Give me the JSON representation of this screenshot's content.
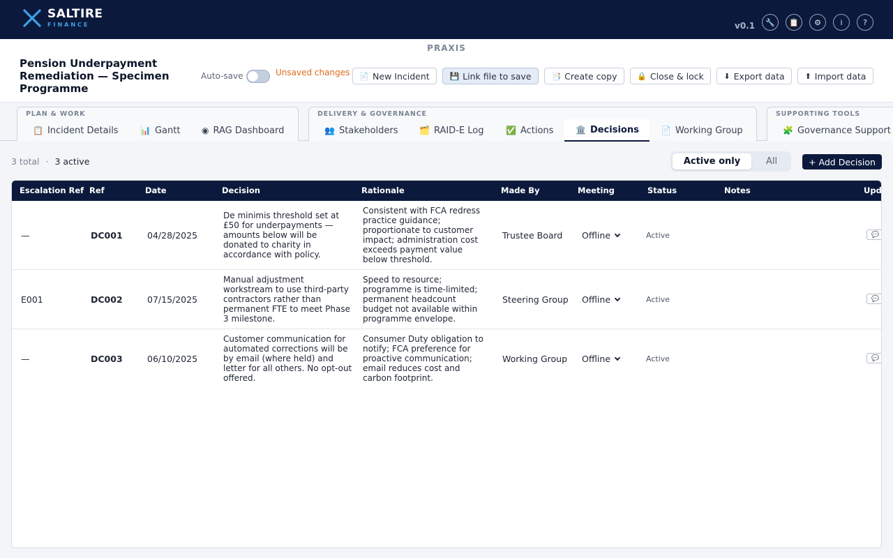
{
  "brand": {
    "name": "SALTIRE",
    "sub": "FINANCE",
    "version": "v0.1"
  },
  "top_icons": [
    "wrench-icon",
    "clipboard-icon",
    "gear-icon",
    "info-icon",
    "help-icon"
  ],
  "top_icon_glyphs": [
    "🔧",
    "📋",
    "⚙",
    "i",
    "?"
  ],
  "app_label": "PRAXIS",
  "programme_title": "Pension Underpayment Remediation — Specimen Programme",
  "autosave": {
    "label": "Auto-save",
    "enabled": false,
    "unsaved": "Unsaved changes"
  },
  "header_buttons": {
    "new_incident": "New Incident",
    "link_file": "Link file to save",
    "create_copy": "Create copy",
    "close_lock": "Close & lock",
    "export": "Export data",
    "import": "Import data"
  },
  "tab_groups": {
    "plan": {
      "label": "PLAN & WORK",
      "tabs": [
        "Incident Details",
        "Gantt",
        "RAG Dashboard"
      ]
    },
    "delivery": {
      "label": "DELIVERY & GOVERNANCE",
      "tabs": [
        "Stakeholders",
        "RAID-E Log",
        "Actions",
        "Decisions",
        "Working Group"
      ]
    },
    "support": {
      "label": "SUPPORTING TOOLS",
      "tabs": [
        "Governance Support"
      ]
    }
  },
  "active_tab": "Decisions",
  "summary": {
    "total": "3 total",
    "sep": "·",
    "active": "3 active"
  },
  "filter": {
    "active_only": "Active only",
    "all": "All",
    "selected": "Active only"
  },
  "add_button": "+ Add Decision",
  "table": {
    "headers": {
      "escalation": "Escalation Ref",
      "ref": "Ref",
      "date": "Date",
      "decision": "Decision",
      "rationale": "Rationale",
      "made_by": "Made By",
      "meeting": "Meeting",
      "status": "Status",
      "notes": "Notes",
      "updates": "Upda"
    },
    "rows": [
      {
        "escalation": "—",
        "ref": "DC001",
        "date": "04/28/2025",
        "decision": "De minimis threshold set at £50 for underpayments — amounts below will be donated to charity in accordance with policy.",
        "rationale": "Consistent with FCA redress practice guidance; proportionate to customer impact; administration cost exceeds payment value below threshold.",
        "made_by": "Trustee Board",
        "meeting": "Offline",
        "status": "Active",
        "notes": ""
      },
      {
        "escalation": "E001",
        "ref": "DC002",
        "date": "07/15/2025",
        "decision": "Manual adjustment workstream to use third-party contractors rather than permanent FTE to meet Phase 3 milestone.",
        "rationale": "Speed to resource; programme is time-limited; permanent headcount budget not available within programme envelope.",
        "made_by": "Steering Group",
        "meeting": "Offline",
        "status": "Active",
        "notes": ""
      },
      {
        "escalation": "—",
        "ref": "DC003",
        "date": "06/10/2025",
        "decision": "Customer communication for automated corrections will be by email (where held) and letter for all others. No opt-out offered.",
        "rationale": "Consumer Duty obligation to notify; FCA preference for proactive communication; email reduces cost and carbon footprint.",
        "made_by": "Working Group",
        "meeting": "Offline",
        "status": "Active",
        "notes": ""
      }
    ]
  },
  "colors": {
    "navy": "#0b1a3c",
    "accent_blue": "#3ea0e8",
    "warning_orange": "#e06a1b"
  }
}
